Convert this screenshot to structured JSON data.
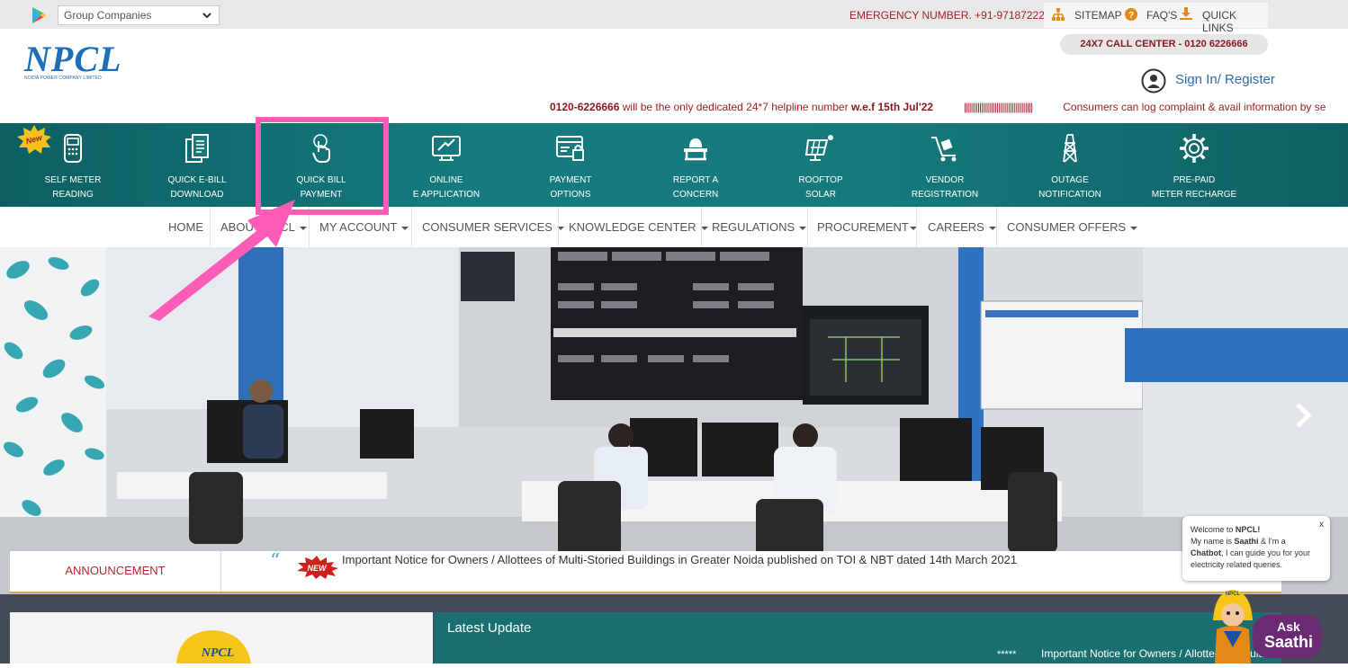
{
  "topbar": {
    "group_select": "Group Companies",
    "emergency": "EMERGENCY NUMBER. +91-9718722222",
    "links": [
      {
        "label": "SITEMAP",
        "icon": "sitemap-icon"
      },
      {
        "label": "FAQ'S",
        "icon": "question-icon"
      },
      {
        "label": "QUICK LINKS",
        "icon": "download-icon"
      }
    ]
  },
  "header": {
    "logo": "NPCL",
    "logo_sub": "NOIDA POWER COMPANY LIMITED",
    "call_center": "24X7 CALL CENTER - 0120 6226666",
    "signin": "Sign In/ Register"
  },
  "ticker": {
    "number": "0120-6226666",
    "text1": " will be the only dedicated 24*7 helpline number ",
    "date": "w.e.f 15th Jul'22",
    "bars": "||||||||||||||||||||||||||||||||||||",
    "text2": "Consumers can log complaint & avail information by se"
  },
  "quick_links": {
    "new_badge": "New",
    "items": [
      {
        "l1": "SELF METER",
        "l2": "READING",
        "icon": "meter-icon"
      },
      {
        "l1": "QUICK E-BILL",
        "l2": "DOWNLOAD",
        "icon": "bill-download-icon"
      },
      {
        "l1": "QUICK BILL",
        "l2": "PAYMENT",
        "icon": "touch-payment-icon"
      },
      {
        "l1": "ONLINE",
        "l2": "E APPLICATION",
        "icon": "online-application-icon"
      },
      {
        "l1": "PAYMENT",
        "l2": "OPTIONS",
        "icon": "payment-options-icon"
      },
      {
        "l1": "REPORT A",
        "l2": "CONCERN",
        "icon": "report-concern-icon"
      },
      {
        "l1": "ROOFTOP",
        "l2": "SOLAR",
        "icon": "solar-panel-icon"
      },
      {
        "l1": "VENDOR",
        "l2": "REGISTRATION",
        "icon": "vendor-cart-icon"
      },
      {
        "l1": "OUTAGE",
        "l2": "NOTIFICATION",
        "icon": "tower-icon"
      },
      {
        "l1": "PRE-PAID",
        "l2": "METER RECHARGE",
        "icon": "gear-recharge-icon"
      }
    ]
  },
  "nav": {
    "home": "HOME",
    "about": "ABOUT NPCL",
    "account": "MY ACCOUNT",
    "consumer_services": "CONSUMER SERVICES",
    "knowledge": "KNOWLEDGE CENTER",
    "regulations": "REGULATIONS",
    "procurement": "PROCUREMENT",
    "careers": "CAREERS",
    "offers": "CONSUMER OFFERS"
  },
  "announcement": {
    "label": "ANNOUNCEMENT",
    "badge": "NEW",
    "text": "Important Notice for Owners / Allottees of Multi-Storied Buildings in Greater Noida published on TOI & NBT dated 14th March 2021"
  },
  "chat": {
    "close": "x",
    "welcome_pre": "Welcome to ",
    "welcome_brand": "NPCL!",
    "line2_pre": "My name is ",
    "line2_name": "Saathi",
    "line2_post": " & I'm a",
    "line3_bold": "Chatbot",
    "line3_post": ", I can guide you for your",
    "line4": "electricity related queries.",
    "ask": "Ask",
    "saathi": "Saathi",
    "cap": "NPCL"
  },
  "latest": {
    "title": "Latest Update",
    "stars": "*****",
    "text": "Important Notice for Owners / Allottees of Multi-Storied Buildings"
  },
  "bottom_left": {
    "cap": "NPCL"
  },
  "colors": {
    "brand_blue": "#1c6fb7",
    "teal": "#167a7d",
    "red": "#a0232a",
    "highlight_pink": "#ff5cb8"
  }
}
